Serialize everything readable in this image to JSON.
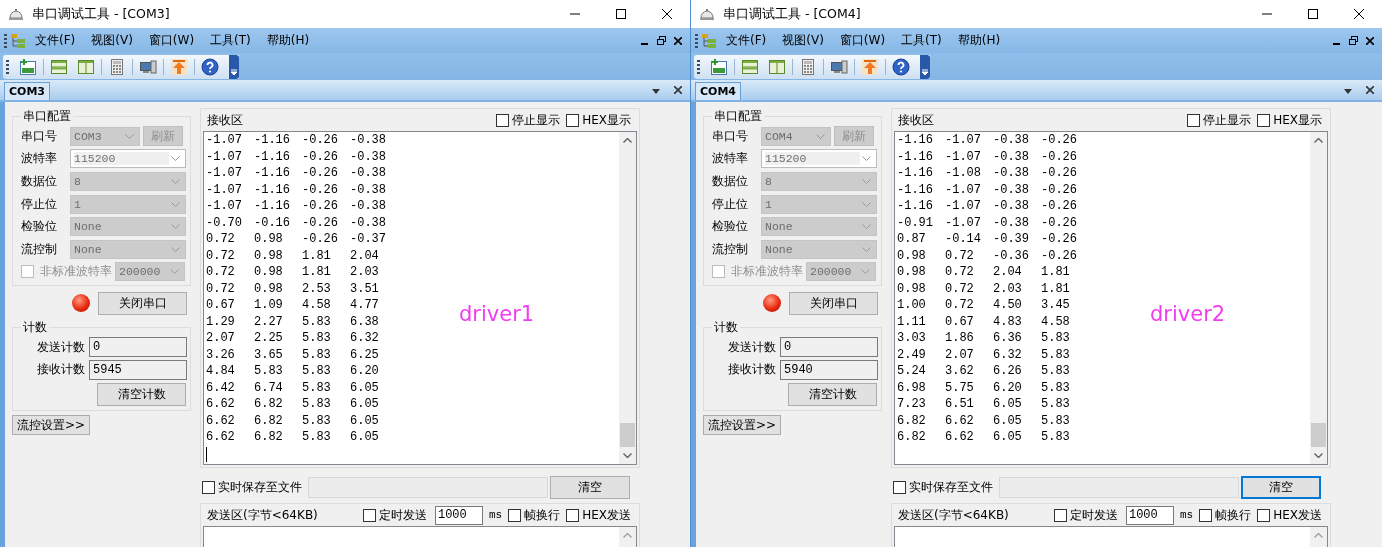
{
  "windows": [
    {
      "title": "串口调试工具 - [COM3]",
      "menu": [
        "文件(F)",
        "视图(V)",
        "窗口(W)",
        "工具(T)",
        "帮助(H)"
      ],
      "tabs": [
        {
          "label": "COM3",
          "selected": true
        }
      ],
      "config": {
        "title": "串口配置",
        "fields": [
          {
            "label": "串口号",
            "value": "COM3",
            "disabled": true
          },
          {
            "label": "波特率",
            "value": "115200",
            "disabled": false
          },
          {
            "label": "数据位",
            "value": "8",
            "disabled": true
          },
          {
            "label": "停止位",
            "value": "1",
            "disabled": true
          },
          {
            "label": "检验位",
            "value": "None",
            "disabled": true
          },
          {
            "label": "流控制",
            "value": "None",
            "disabled": true
          }
        ],
        "refresh_button": {
          "label": "刷新",
          "disabled": true
        },
        "custom_baud": {
          "label": "非标准波特率",
          "checked": false,
          "disabled": true,
          "value": "200000"
        }
      },
      "led": {
        "on": true
      },
      "port_button": "关闭串口",
      "counter": {
        "title": "计数",
        "sent_label": "发送计数",
        "sent": "0",
        "received_label": "接收计数",
        "received": "5945",
        "clear_button": "清空计数"
      },
      "flow_button": "流控设置>>",
      "receive": {
        "title": "接收区",
        "options": [
          {
            "label": "停止显示",
            "checked": false
          },
          {
            "label": "HEX显示",
            "checked": false
          }
        ],
        "lines": [
          "-1.07\t-1.16\t-0.26\t-0.38",
          "-1.07\t-1.16\t-0.26\t-0.38",
          "-1.07\t-1.16\t-0.26\t-0.38",
          "-1.07\t-1.16\t-0.26\t-0.38",
          "-1.07\t-1.16\t-0.26\t-0.38",
          "-0.70\t-0.16\t-0.26\t-0.38",
          "0.72\t0.98\t-0.26\t-0.37",
          "0.72\t0.98\t1.81\t2.04",
          "0.72\t0.98\t1.81\t2.03",
          "0.72\t0.98\t2.53\t3.51",
          "0.67\t1.09\t4.58\t4.77",
          "1.29\t2.27\t5.83\t6.38",
          "2.07\t2.25\t5.83\t6.32",
          "3.26\t3.65\t5.83\t6.25",
          "4.84\t5.83\t5.83\t6.20",
          "6.42\t6.74\t5.83\t6.05",
          "6.62\t6.82\t5.83\t6.05",
          "6.62\t6.82\t5.83\t6.05",
          "6.62\t6.82\t5.83\t6.05"
        ],
        "cursor": true,
        "annotation": "driver1"
      },
      "save": {
        "label": "实时保存至文件",
        "checked": false,
        "clear_button": {
          "label": "清空",
          "focused": false
        }
      },
      "send": {
        "title": "发送区(字节<64KB)",
        "timed": {
          "label": "定时发送",
          "checked": false
        },
        "interval": "1000",
        "unit": "ms",
        "options": [
          {
            "label": "帧换行",
            "checked": false
          },
          {
            "label": "HEX发送",
            "checked": false
          }
        ]
      }
    },
    {
      "title": "串口调试工具 - [COM4]",
      "menu": [
        "文件(F)",
        "视图(V)",
        "窗口(W)",
        "工具(T)",
        "帮助(H)"
      ],
      "tabs": [
        {
          "label": "COM4",
          "selected": true
        }
      ],
      "config": {
        "title": "串口配置",
        "fields": [
          {
            "label": "串口号",
            "value": "COM4",
            "disabled": true
          },
          {
            "label": "波特率",
            "value": "115200",
            "disabled": false
          },
          {
            "label": "数据位",
            "value": "8",
            "disabled": true
          },
          {
            "label": "停止位",
            "value": "1",
            "disabled": true
          },
          {
            "label": "检验位",
            "value": "None",
            "disabled": true
          },
          {
            "label": "流控制",
            "value": "None",
            "disabled": true
          }
        ],
        "refresh_button": {
          "label": "刷新",
          "disabled": true
        },
        "custom_baud": {
          "label": "非标准波特率",
          "checked": false,
          "disabled": true,
          "value": "200000"
        }
      },
      "led": {
        "on": true
      },
      "port_button": "关闭串口",
      "counter": {
        "title": "计数",
        "sent_label": "发送计数",
        "sent": "0",
        "received_label": "接收计数",
        "received": "5940",
        "clear_button": "清空计数"
      },
      "flow_button": "流控设置>>",
      "receive": {
        "title": "接收区",
        "options": [
          {
            "label": "停止显示",
            "checked": false
          },
          {
            "label": "HEX显示",
            "checked": false
          }
        ],
        "lines": [
          "-1.16\t-1.07\t-0.38\t-0.26",
          "-1.16\t-1.07\t-0.38\t-0.26",
          "-1.16\t-1.08\t-0.38\t-0.26",
          "-1.16\t-1.07\t-0.38\t-0.26",
          "-1.16\t-1.07\t-0.38\t-0.26",
          "-0.91\t-1.07\t-0.38\t-0.26",
          "0.87\t-0.14\t-0.39\t-0.26",
          "0.98\t0.72\t-0.36\t-0.26",
          "0.98\t0.72\t2.04\t1.81",
          "0.98\t0.72\t2.03\t1.81",
          "1.00\t0.72\t4.50\t3.45",
          "1.11\t0.67\t4.83\t4.58",
          "3.03\t1.86\t6.36\t5.83",
          "2.49\t2.07\t6.32\t5.83",
          "5.24\t3.62\t6.26\t5.83",
          "6.98\t5.75\t6.20\t5.83",
          "7.23\t6.51\t6.05\t5.83",
          "6.82\t6.62\t6.05\t5.83",
          "6.82\t6.62\t6.05\t5.83"
        ],
        "cursor": false,
        "annotation": "driver2"
      },
      "save": {
        "label": "实时保存至文件",
        "checked": false,
        "clear_button": {
          "label": "清空",
          "focused": true
        }
      },
      "send": {
        "title": "发送区(字节<64KB)",
        "timed": {
          "label": "定时发送",
          "checked": false
        },
        "interval": "1000",
        "unit": "ms",
        "options": [
          {
            "label": "帧换行",
            "checked": false
          },
          {
            "label": "HEX发送",
            "checked": false
          }
        ]
      }
    }
  ]
}
